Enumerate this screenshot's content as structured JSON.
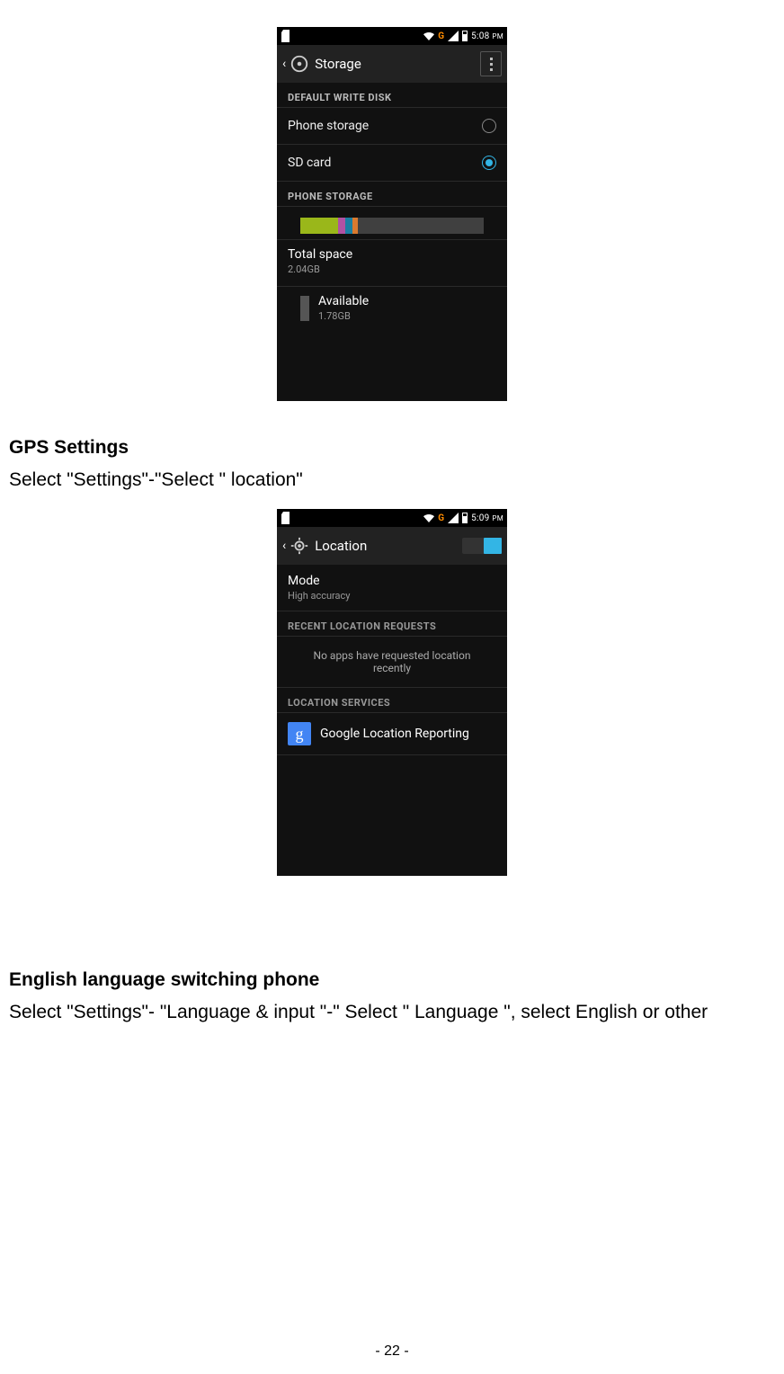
{
  "page_number_text": "- 22 -",
  "shot1": {
    "statusbar": {
      "net": "G",
      "time": "5:08",
      "ampm": "PM"
    },
    "title": "Storage",
    "section_default": "DEFAULT WRITE DISK",
    "opt_phone": "Phone storage",
    "opt_sd": "SD card",
    "section_phone": "PHONE STORAGE",
    "total_label": "Total space",
    "total_value": "2.04GB",
    "avail_label": "Available",
    "avail_value": "1.78GB"
  },
  "section1": {
    "heading": "GPS Settings",
    "body": "Select \"Settings\"-\"Select \" location\""
  },
  "shot2": {
    "statusbar": {
      "net": "G",
      "time": "5:09",
      "ampm": "PM"
    },
    "title": "Location",
    "mode_label": "Mode",
    "mode_value": "High accuracy",
    "section_recent": "RECENT LOCATION REQUESTS",
    "no_apps": "No apps have requested location recently",
    "section_services": "LOCATION SERVICES",
    "google_item": "Google Location Reporting"
  },
  "section2": {
    "heading": "English language switching phone",
    "body": "Select \"Settings\"- \"Language & input \"-\" Select \" Language \", select English or other"
  }
}
